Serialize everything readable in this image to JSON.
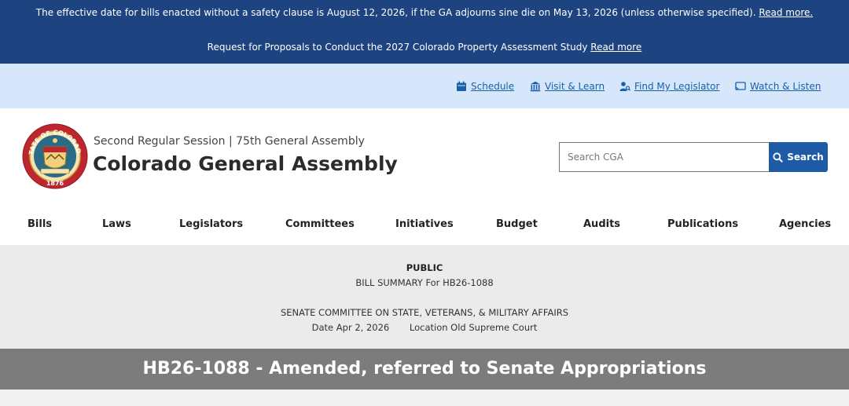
{
  "alerts": [
    {
      "text": "The effective date for bills enacted without a safety clause is August 12, 2026, if the GA adjourns sine die on May 13, 2026 (unless otherwise specified).",
      "link": "Read more."
    },
    {
      "text": "Request for Proposals to Conduct the 2027 Colorado Property Assessment Study",
      "link": "Read more"
    }
  ],
  "utility_nav": [
    {
      "label": "Schedule",
      "icon": "calendar-icon"
    },
    {
      "label": "Visit & Learn",
      "icon": "capitol-building-icon"
    },
    {
      "label": "Find My Legislator",
      "icon": "person-search-icon"
    },
    {
      "label": "Watch & Listen",
      "icon": "cast-screen-icon"
    }
  ],
  "header": {
    "seal_text_top": "STATE OF COLORADO",
    "seal_year": "1876",
    "session": "Second Regular Session | 75th General Assembly",
    "title": "Colorado General Assembly",
    "search_placeholder": "Search CGA",
    "search_button": "Search"
  },
  "main_nav": [
    "Bills",
    "Laws",
    "Legislators",
    "Committees",
    "Initiatives",
    "Budget",
    "Audits",
    "Publications",
    "Agencies"
  ],
  "summary": {
    "visibility": "PUBLIC",
    "heading": "BILL SUMMARY For HB26-1088",
    "committee": "SENATE COMMITTEE ON STATE, VETERANS, & MILITARY AFFAIRS",
    "date": "Date Apr 2, 2026",
    "location": "Location Old Supreme Court"
  },
  "result": "HB26-1088 - Amended, referred to Senate Appropriations",
  "colors": {
    "alert_bg": "#1d4381",
    "utility_bg": "#d6e7fb",
    "link_blue": "#1b5fa8",
    "search_button_bg": "#1d5ba6",
    "summary_bg": "#ebebeb",
    "result_bg": "#7c7c7c"
  }
}
